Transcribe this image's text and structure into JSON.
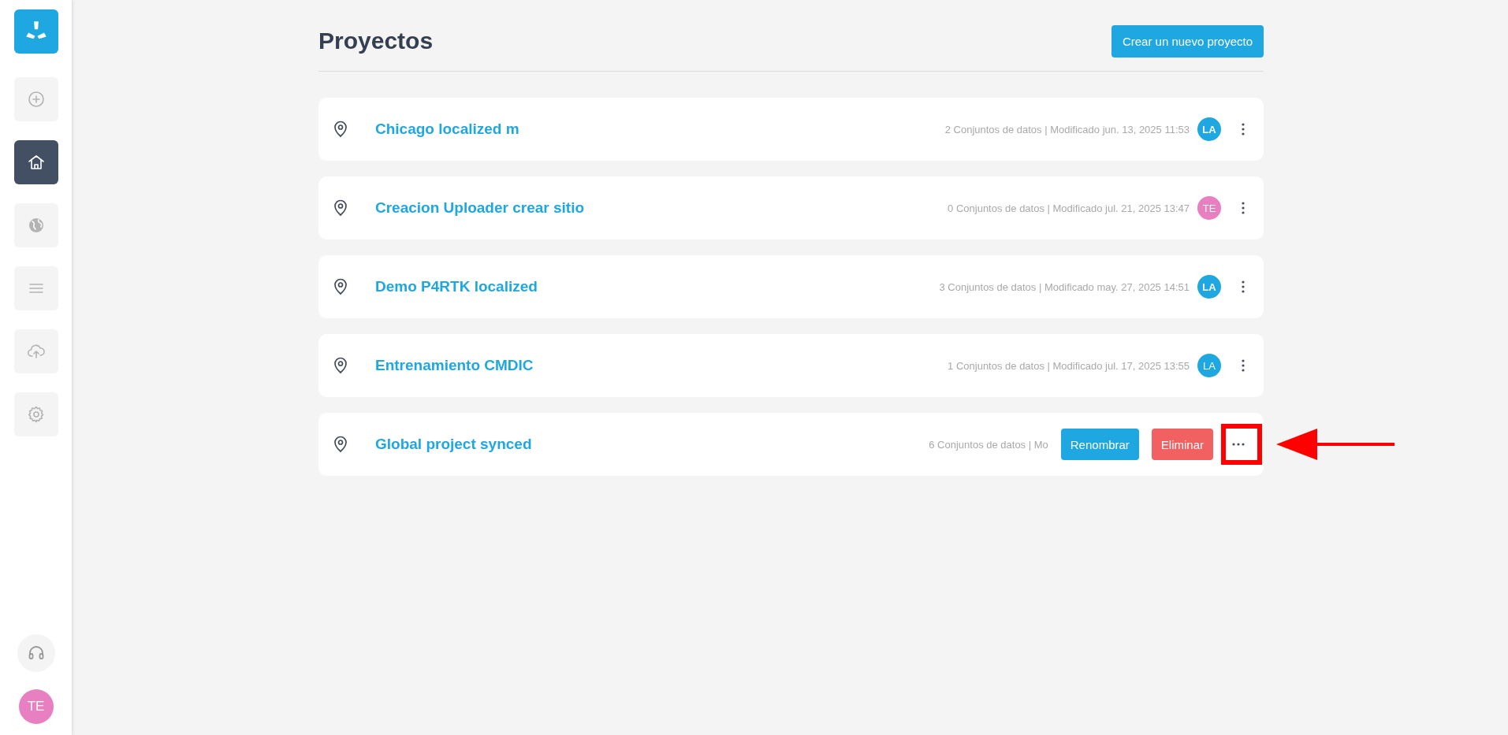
{
  "sidebar": {
    "items": [
      {
        "kind": "add",
        "selected": false
      },
      {
        "kind": "home",
        "selected": true
      },
      {
        "kind": "globe",
        "selected": false
      },
      {
        "kind": "list",
        "selected": false
      },
      {
        "kind": "upload",
        "selected": false
      },
      {
        "kind": "settings",
        "selected": false
      }
    ],
    "user": {
      "initials": "TE",
      "color": "#e87fc0"
    }
  },
  "page": {
    "title": "Proyectos",
    "create_button": "Crear un nuevo proyecto"
  },
  "projects": [
    {
      "name": "Chicago localized m",
      "meta": "2 Conjuntos de datos | Modificado jun. 13, 2025 11:53",
      "owner": "LA",
      "color": "#1ea7e0",
      "menu_open": false
    },
    {
      "name": "Creacion Uploader crear sitio",
      "meta": "0 Conjuntos de datos | Modificado jul. 21, 2025 13:47",
      "owner": "TE",
      "color": "#e87fc0",
      "menu_open": false
    },
    {
      "name": "Demo P4RTK localized",
      "meta": "3 Conjuntos de datos | Modificado may. 27, 2025 14:51",
      "owner": "LA",
      "color": "#1ea7e0",
      "menu_open": false
    },
    {
      "name": "Entrenamiento CMDIC",
      "meta": "1 Conjuntos de datos | Modificado jul. 17, 2025 13:55",
      "owner": "LA",
      "color": "#1ea7e0",
      "menu_open": false
    },
    {
      "name": "Global project synced",
      "meta": "6 Conjuntos de datos | Mo",
      "menu_open": true,
      "actions": [
        "Renombrar",
        "Eliminar"
      ],
      "annotated": true
    }
  ]
}
